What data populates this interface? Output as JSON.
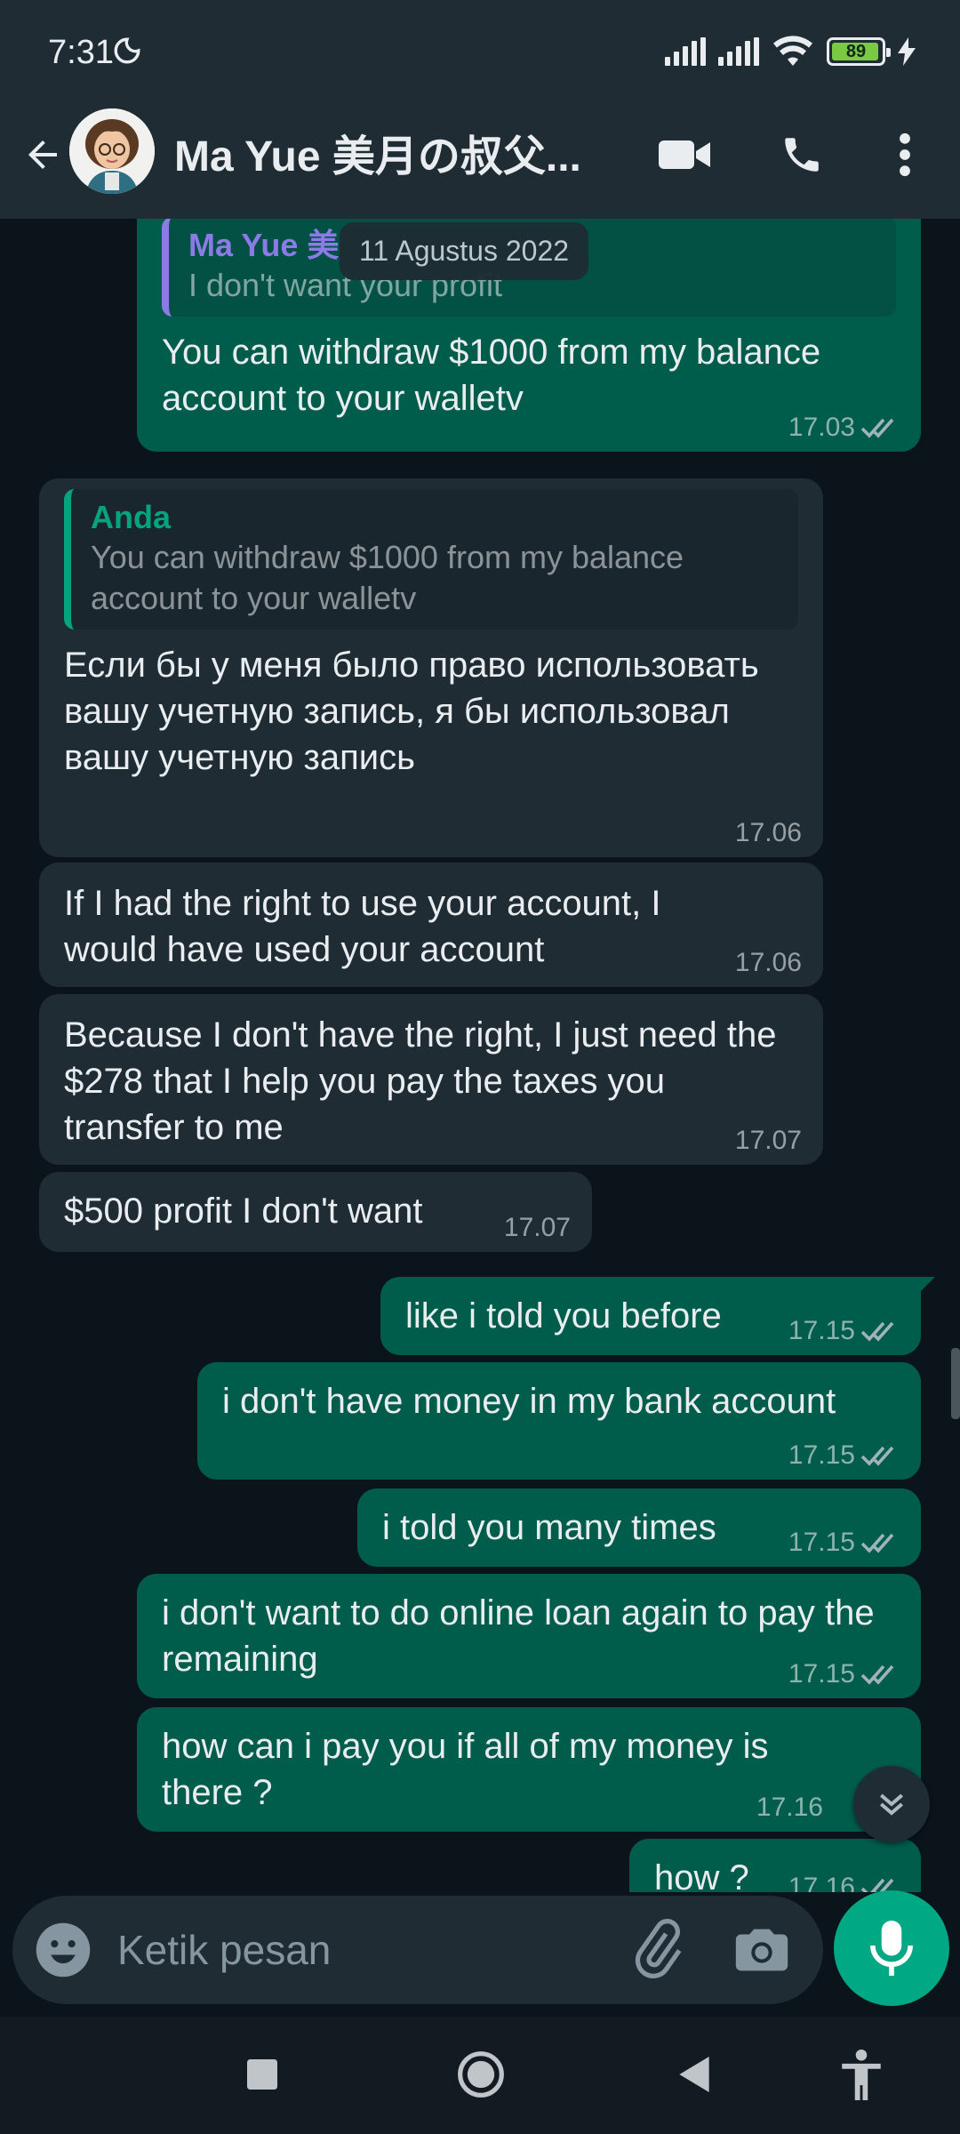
{
  "status_bar": {
    "time": "7:31",
    "battery": "89"
  },
  "header": {
    "contact_name": "Ma Yue 美月の叔父..."
  },
  "date_chip": "11 Agustus 2022",
  "messages": [
    {
      "dir": "out",
      "quote_author": "Ma Yue 美",
      "quote_text": "I don't want your profit",
      "text": "You can withdraw $1000 from my balance account to your walletv",
      "time": "17.03"
    },
    {
      "dir": "in",
      "quote_author": "Anda",
      "quote_text": "You can withdraw $1000 from my balance account to your walletv",
      "text": "Если бы у меня было право использовать вашу учетную запись, я бы использовал вашу учетную запись",
      "time": "17.06"
    },
    {
      "dir": "in",
      "text": "If I had the right to use your account, I would have used your account",
      "time": "17.06"
    },
    {
      "dir": "in",
      "text": "Because I don't have the right, I just need the $278 that I help you pay the taxes you transfer to me",
      "time": "17.07"
    },
    {
      "dir": "in",
      "text": "$500 profit I don't want",
      "time": "17.07"
    },
    {
      "dir": "out",
      "text": "like i told you before",
      "time": "17.15"
    },
    {
      "dir": "out",
      "text": "i don't have money in my bank account",
      "time": "17.15"
    },
    {
      "dir": "out",
      "text": "i told you many times",
      "time": "17.15"
    },
    {
      "dir": "out",
      "text": "i don't want to do online loan again to pay the remaining",
      "time": "17.15"
    },
    {
      "dir": "out",
      "text": "how can i pay you if all of my money is there ?",
      "time": "17.16"
    },
    {
      "dir": "out",
      "text": "how ?",
      "time": "17.16"
    }
  ],
  "composer": {
    "placeholder": "Ketik pesan"
  },
  "colors": {
    "header_bg": "#1f2c34",
    "chat_bg": "#0b141a",
    "outgoing_bubble": "#005c4b",
    "incoming_bubble": "#1f2c34",
    "accent": "#00a884",
    "read_tick": "#9fb3b9",
    "quote_out_author": "#8c7ae6",
    "quote_in_author": "#06a37f"
  }
}
